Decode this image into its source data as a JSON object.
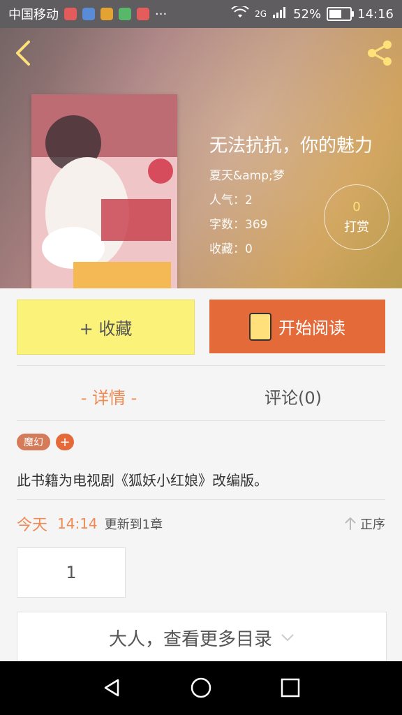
{
  "status_bar": {
    "carrier": "中国移动",
    "more": "···",
    "network": "2G",
    "battery": "52%",
    "battery_level": 0.52,
    "time": "14:16"
  },
  "header": {
    "title": "无法抗抗，你的魅力",
    "author": "夏天&amp;梦",
    "popularity_label": "人气：",
    "popularity_value": "2",
    "words_label": "字数：",
    "words_value": "369",
    "collect_label": "收藏：",
    "collect_value": "0",
    "tip_count": "0",
    "tip_label": "打赏"
  },
  "actions": {
    "collect": "+ 收藏",
    "read": "开始阅读"
  },
  "tabs": {
    "details": "- 详情 -",
    "comments": "评论(0)"
  },
  "tags": [
    {
      "label": "魔幻"
    },
    {
      "label": "+"
    }
  ],
  "description": "此书籍为电视剧《狐妖小红娘》改编版。",
  "update": {
    "day": "今天",
    "time": "14:14",
    "text": "更新到1章",
    "sort": "正序"
  },
  "chapters": [
    "1"
  ],
  "more": "大人，查看更多目录",
  "colors": {
    "accent_orange": "#e46a3a",
    "accent_yellow": "#fbf27a",
    "tab_active": "#ee8a52"
  }
}
